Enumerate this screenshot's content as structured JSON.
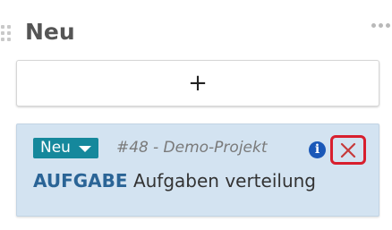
{
  "column": {
    "title": "Neu"
  },
  "add_button": {
    "icon": "plus-icon",
    "label": "+"
  },
  "card": {
    "status": "Neu",
    "id": "#48",
    "project": "- Demo-Projekt",
    "type": "AUFGABE",
    "title": "Aufgaben verteilung",
    "info_icon": "info-icon",
    "info_glyph": "i",
    "close_icon": "close-icon"
  },
  "colors": {
    "card_background": "#d3e3f1",
    "status_badge": "#15889c",
    "type_label": "#2a6496",
    "info_icon": "#1a58b8",
    "close_highlight": "#d81f2e",
    "close_x": "#c63a3a"
  }
}
